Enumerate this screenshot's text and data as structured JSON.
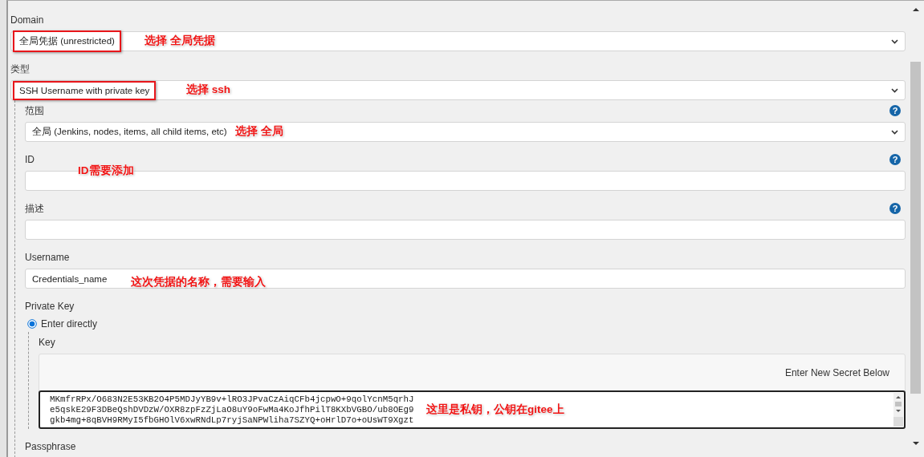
{
  "fields": [
    {
      "kind": "select",
      "label": "Domain",
      "value": "全局凭据 (unrestricted)",
      "highlighted": true,
      "annotation": "选择 全局凭据"
    },
    {
      "kind": "select",
      "label": "类型",
      "value": "SSH Username with private key",
      "highlighted": true,
      "annotation": "选择 ssh",
      "children": [
        {
          "kind": "select",
          "label": "范围",
          "value": "全局 (Jenkins, nodes, items, all child items, etc)",
          "help": "?",
          "highlighted": false,
          "annotation": "选择 全局"
        },
        {
          "kind": "text",
          "label": "ID",
          "help": "?",
          "annotation": "ID需要添加"
        },
        {
          "kind": "text",
          "label": "描述",
          "help": "?"
        },
        {
          "kind": "text",
          "label": "Username",
          "value": "Credentials_name",
          "annotation": "这次凭据的名称，需要输入"
        },
        {
          "kind": "private_key",
          "label": "Private Key",
          "option": {
            "label": "Enter directly",
            "selected": true
          },
          "key_label": "Key",
          "secret_hint": "Enter New Secret Below",
          "annotation": "这里是私钥，公钥在gitee上",
          "key_lines": [
            "MKmfrRPx/O683N2E53KB2O4P5MDJyYB9v+lRO3JPvaCzAiqCFb4jcpwO+9qolYcnM5qrhJ",
            "e5qskE29F3DBeQshDVDzW/OXR8zpFzZjLaO8uY9oFwMa4KoJfhPilT8KXbVGBO/ub8OEg9",
            "gkb4mg+8qBVH9RMyI5fbGHOlV6xwRNdLp7ryjSaNPWliha7SZYQ+oHrlD7o+oUsWT9Xgzt"
          ]
        },
        {
          "kind": "text",
          "label": "Passphrase"
        }
      ]
    }
  ]
}
